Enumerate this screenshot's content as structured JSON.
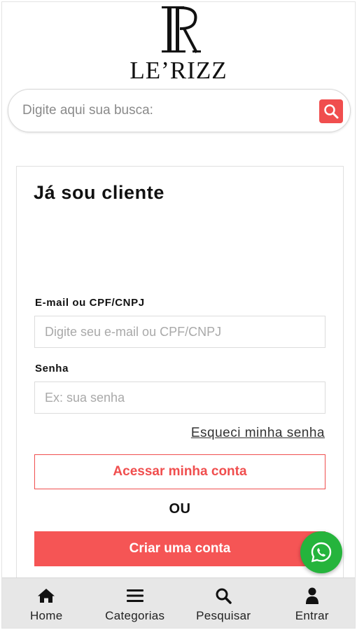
{
  "brand": {
    "monogram": "LR",
    "wordmark": "LE’RIZZ"
  },
  "search": {
    "placeholder": "Digite aqui sua busca:",
    "icon": "search-icon"
  },
  "login": {
    "title": "Já sou cliente",
    "email_label": "E-mail ou CPF/CNPJ",
    "email_placeholder": "Digite seu e-mail ou CPF/CNPJ",
    "password_label": "Senha",
    "password_placeholder": "Ex: sua senha",
    "forgot_link": "Esqueci minha senha",
    "access_button": "Acessar minha conta",
    "or_text": "OU",
    "create_button": "Criar uma conta"
  },
  "whatsapp": {
    "icon": "whatsapp-icon"
  },
  "nav": {
    "items": [
      {
        "label": "Home",
        "icon": "home-icon"
      },
      {
        "label": "Categorias",
        "icon": "menu-icon"
      },
      {
        "label": "Pesquisar",
        "icon": "search-icon"
      },
      {
        "label": "Entrar",
        "icon": "user-icon"
      }
    ]
  },
  "colors": {
    "accent": "#f04e4e",
    "whatsapp": "#25b43c",
    "nav_background": "#e7e7e7"
  }
}
